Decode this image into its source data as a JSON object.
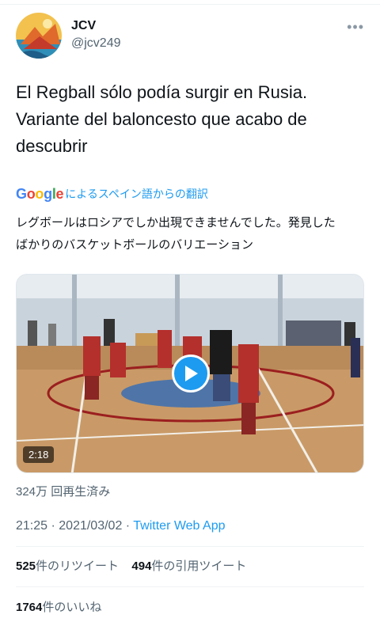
{
  "author": {
    "name": "JCV",
    "handle": "@jcv249"
  },
  "tweet": {
    "text_line1": "El Regball sólo podía surgir en Rusia.",
    "text_line2": "Variante del baloncesto que acabo de",
    "text_line3": "descubrir"
  },
  "translation": {
    "provider": "Google",
    "label": "によるスペイン語からの翻訳",
    "line1": "レグボールはロシアでしか出現できませんでした。発見した",
    "line2": "ばかりのバスケットボールのバリエーション"
  },
  "video": {
    "duration": "2:18"
  },
  "views": "324万 回再生済み",
  "meta": {
    "time": "21:25",
    "date": "2021/03/02",
    "separator": " · ",
    "app": "Twitter Web App"
  },
  "stats": {
    "retweets": "525",
    "retweets_label": "件のリツイート",
    "quotes": "494",
    "quotes_label": "件の引用ツイート",
    "likes": "1764",
    "likes_label": "件のいいね"
  },
  "colors": {
    "accent": "#1d9bf0",
    "secondary_text": "#536471"
  }
}
